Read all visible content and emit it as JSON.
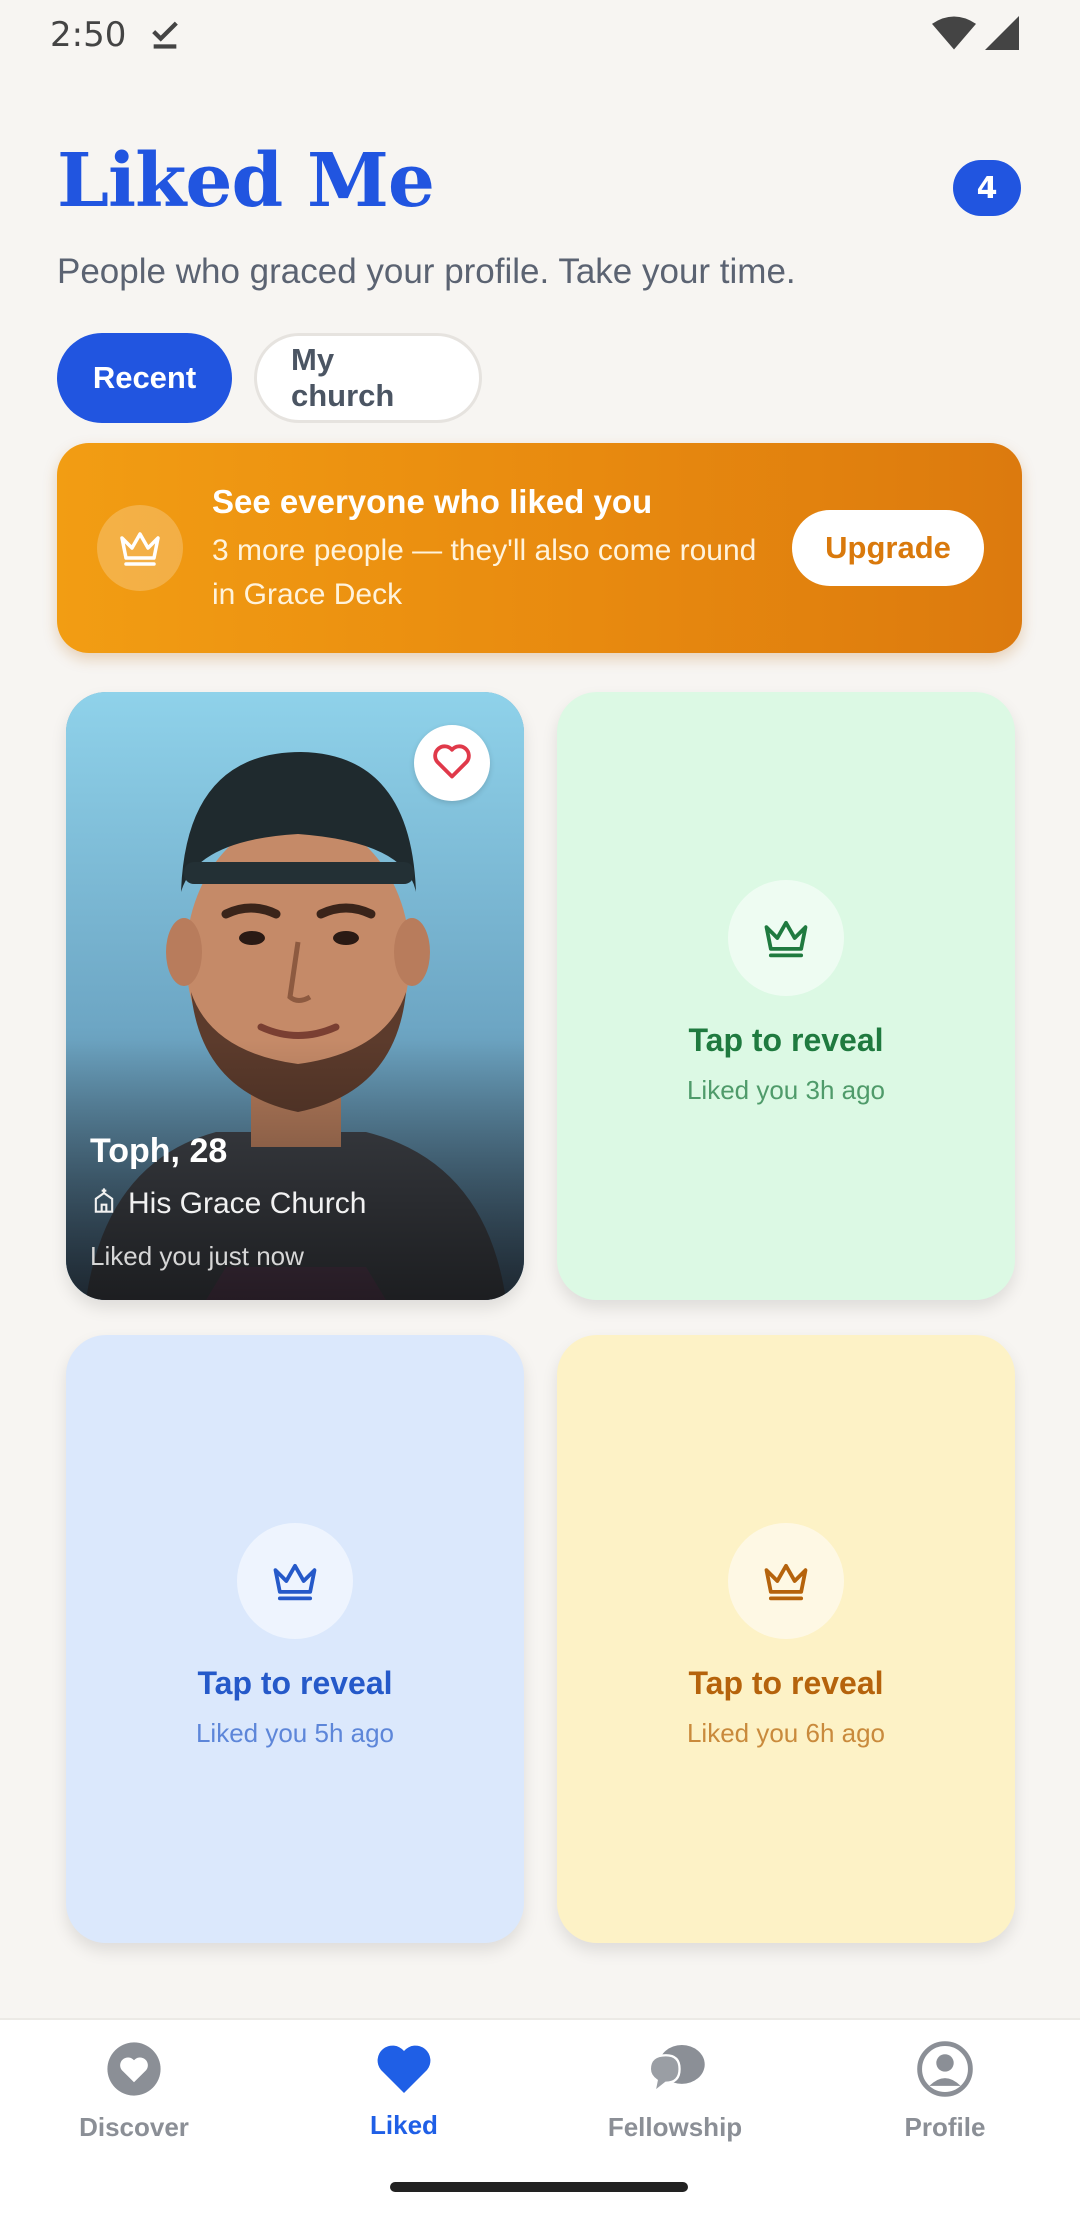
{
  "status_bar": {
    "time": "2:50"
  },
  "header": {
    "title": "Liked Me",
    "count": "4",
    "subtitle": "People who graced your profile. Take your time."
  },
  "tabs": [
    {
      "label": "Recent",
      "active": true
    },
    {
      "label": "My church",
      "active": false
    }
  ],
  "promo": {
    "title": "See everyone who liked you",
    "text": "3 more people — they'll also come round in Grace Deck",
    "button": "Upgrade",
    "icon": "crown-icon"
  },
  "cards": [
    {
      "type": "profile",
      "name": "Toph, 28",
      "church": "His Grace Church",
      "time": "Liked you just now",
      "icon": "heart-icon"
    },
    {
      "type": "locked",
      "title": "Tap to reveal",
      "time": "Liked you 3h ago",
      "accent": "#1f7a3f",
      "sub_color": "#4f9b6a"
    },
    {
      "type": "locked",
      "title": "Tap to reveal",
      "time": "Liked you 5h ago",
      "accent": "#2559c9",
      "sub_color": "#5d86d9"
    },
    {
      "type": "locked",
      "title": "Tap to reveal",
      "time": "Liked you 6h ago",
      "accent": "#b5630c",
      "sub_color": "#c98a3c"
    }
  ],
  "bottom_nav": [
    {
      "label": "Discover",
      "icon": "heart-circle-icon",
      "active": false
    },
    {
      "label": "Liked",
      "icon": "heart-icon",
      "active": true
    },
    {
      "label": "Fellowship",
      "icon": "chat-bubbles-icon",
      "active": false
    },
    {
      "label": "Profile",
      "icon": "person-circle-icon",
      "active": false
    }
  ],
  "colors": {
    "primary": "#2155e0",
    "promo_orange": "#e88a0f",
    "background": "#f7f5f2"
  }
}
